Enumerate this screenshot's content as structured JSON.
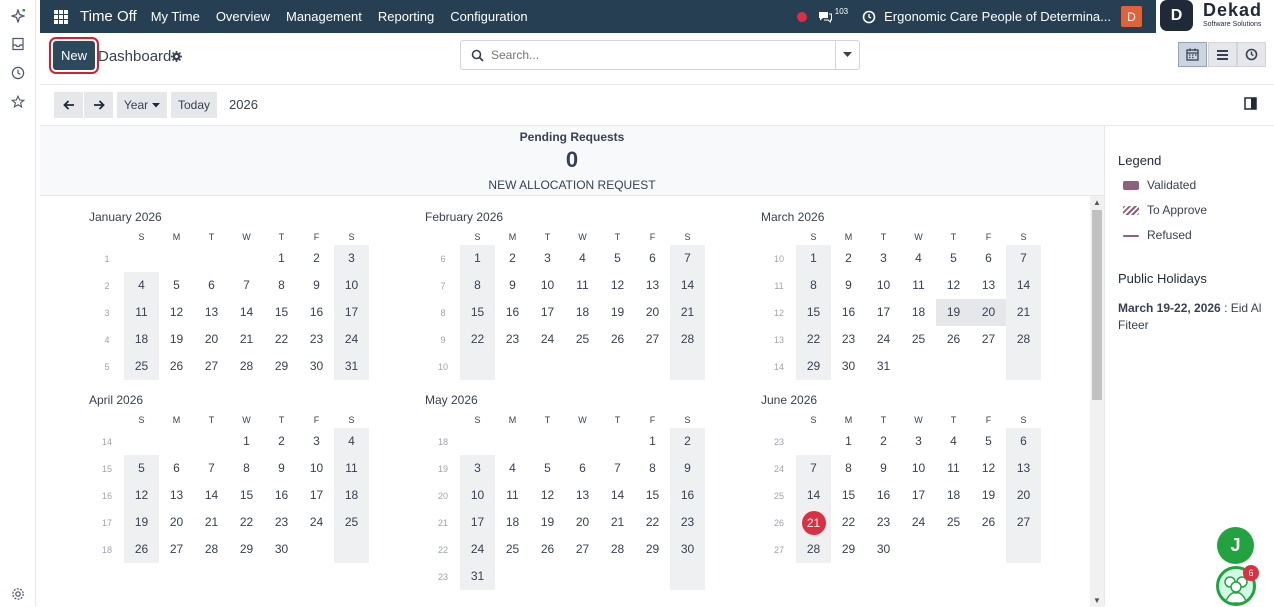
{
  "topbar": {
    "app_title": "Time Off",
    "menu": [
      "My Time",
      "Overview",
      "Management",
      "Reporting",
      "Configuration"
    ],
    "chat_count": "103",
    "company": "Ergonomic Care People of Determina...",
    "user_initial": "D"
  },
  "brand": {
    "mark": "D",
    "name": "Dekad",
    "tagline": "Software Solutions"
  },
  "controls": {
    "new_label": "New",
    "breadcrumb": "Dashboard",
    "search_placeholder": "Search..."
  },
  "nav": {
    "scale_label": "Year",
    "today_label": "Today",
    "year": "2026"
  },
  "pending": {
    "title": "Pending Requests",
    "count": "0",
    "subtitle": "NEW ALLOCATION REQUEST"
  },
  "weekday_headers": [
    "S",
    "M",
    "T",
    "W",
    "T",
    "F",
    "S"
  ],
  "months": [
    {
      "name": "January 2026",
      "weeks": [
        {
          "wk": "1",
          "days": [
            "",
            "",
            "",
            "",
            "1",
            "2",
            "3"
          ]
        },
        {
          "wk": "2",
          "days": [
            "4",
            "5",
            "6",
            "7",
            "8",
            "9",
            "10"
          ]
        },
        {
          "wk": "3",
          "days": [
            "11",
            "12",
            "13",
            "14",
            "15",
            "16",
            "17"
          ]
        },
        {
          "wk": "4",
          "days": [
            "18",
            "19",
            "20",
            "21",
            "22",
            "23",
            "24"
          ]
        },
        {
          "wk": "5",
          "days": [
            "25",
            "26",
            "27",
            "28",
            "29",
            "30",
            "31"
          ]
        }
      ]
    },
    {
      "name": "February 2026",
      "weeks": [
        {
          "wk": "6",
          "days": [
            "1",
            "2",
            "3",
            "4",
            "5",
            "6",
            "7"
          ]
        },
        {
          "wk": "7",
          "days": [
            "8",
            "9",
            "10",
            "11",
            "12",
            "13",
            "14"
          ]
        },
        {
          "wk": "8",
          "days": [
            "15",
            "16",
            "17",
            "18",
            "19",
            "20",
            "21"
          ]
        },
        {
          "wk": "9",
          "days": [
            "22",
            "23",
            "24",
            "25",
            "26",
            "27",
            "28"
          ]
        },
        {
          "wk": "10",
          "days": [
            "",
            "",
            "",
            "",
            "",
            "",
            ""
          ]
        }
      ]
    },
    {
      "name": "March 2026",
      "weeks": [
        {
          "wk": "10",
          "days": [
            "1",
            "2",
            "3",
            "4",
            "5",
            "6",
            "7"
          ]
        },
        {
          "wk": "11",
          "days": [
            "8",
            "9",
            "10",
            "11",
            "12",
            "13",
            "14"
          ]
        },
        {
          "wk": "12",
          "days": [
            "15",
            "16",
            "17",
            "18",
            "19",
            "20",
            "21"
          ]
        },
        {
          "wk": "13",
          "days": [
            "22",
            "23",
            "24",
            "25",
            "26",
            "27",
            "28"
          ]
        },
        {
          "wk": "14",
          "days": [
            "29",
            "30",
            "31",
            "",
            "",
            "",
            ""
          ]
        }
      ]
    },
    {
      "name": "April 2026",
      "weeks": [
        {
          "wk": "14",
          "days": [
            "",
            "",
            "",
            "1",
            "2",
            "3",
            "4"
          ]
        },
        {
          "wk": "15",
          "days": [
            "5",
            "6",
            "7",
            "8",
            "9",
            "10",
            "11"
          ]
        },
        {
          "wk": "16",
          "days": [
            "12",
            "13",
            "14",
            "15",
            "16",
            "17",
            "18"
          ]
        },
        {
          "wk": "17",
          "days": [
            "19",
            "20",
            "21",
            "22",
            "23",
            "24",
            "25"
          ]
        },
        {
          "wk": "18",
          "days": [
            "26",
            "27",
            "28",
            "29",
            "30",
            "",
            ""
          ]
        }
      ]
    },
    {
      "name": "May 2026",
      "weeks": [
        {
          "wk": "18",
          "days": [
            "",
            "",
            "",
            "",
            "",
            "1",
            "2"
          ]
        },
        {
          "wk": "19",
          "days": [
            "3",
            "4",
            "5",
            "6",
            "7",
            "8",
            "9"
          ]
        },
        {
          "wk": "20",
          "days": [
            "10",
            "11",
            "12",
            "13",
            "14",
            "15",
            "16"
          ]
        },
        {
          "wk": "21",
          "days": [
            "17",
            "18",
            "19",
            "20",
            "21",
            "22",
            "23"
          ]
        },
        {
          "wk": "22",
          "days": [
            "24",
            "25",
            "26",
            "27",
            "28",
            "29",
            "30"
          ]
        },
        {
          "wk": "23",
          "days": [
            "31",
            "",
            "",
            "",
            "",
            "",
            ""
          ]
        }
      ]
    },
    {
      "name": "June 2026",
      "weeks": [
        {
          "wk": "23",
          "days": [
            "",
            "1",
            "2",
            "3",
            "4",
            "5",
            "6"
          ]
        },
        {
          "wk": "24",
          "days": [
            "7",
            "8",
            "9",
            "10",
            "11",
            "12",
            "13"
          ]
        },
        {
          "wk": "25",
          "days": [
            "14",
            "15",
            "16",
            "17",
            "18",
            "19",
            "20"
          ]
        },
        {
          "wk": "26",
          "days": [
            "21",
            "22",
            "23",
            "24",
            "25",
            "26",
            "27"
          ]
        },
        {
          "wk": "27",
          "days": [
            "28",
            "29",
            "30",
            "",
            "",
            "",
            ""
          ]
        }
      ]
    }
  ],
  "today": {
    "month": "June 2026",
    "day": "21"
  },
  "holiday_days": {
    "month": "March 2026",
    "days": [
      "19",
      "20"
    ]
  },
  "legend": {
    "title": "Legend",
    "items": [
      {
        "label": "Validated",
        "color": "#8e5f7e",
        "style": "solid"
      },
      {
        "label": "To Approve",
        "color": "#8e5f7e",
        "style": "hatched"
      },
      {
        "label": "Refused",
        "color": "#8e5f7e",
        "style": "line"
      }
    ]
  },
  "public_holidays": {
    "title": "Public Holidays",
    "entries": [
      {
        "date": "March 19-22, 2026",
        "name": "Eid Al Fiteer"
      }
    ]
  },
  "floating": {
    "assistant_initial": "J",
    "chat_badge": "6"
  },
  "colors": {
    "topbar": "#263f52",
    "primary": "#2d4a5c",
    "today": "#dc2f44",
    "weekend": "#eef0f2"
  }
}
